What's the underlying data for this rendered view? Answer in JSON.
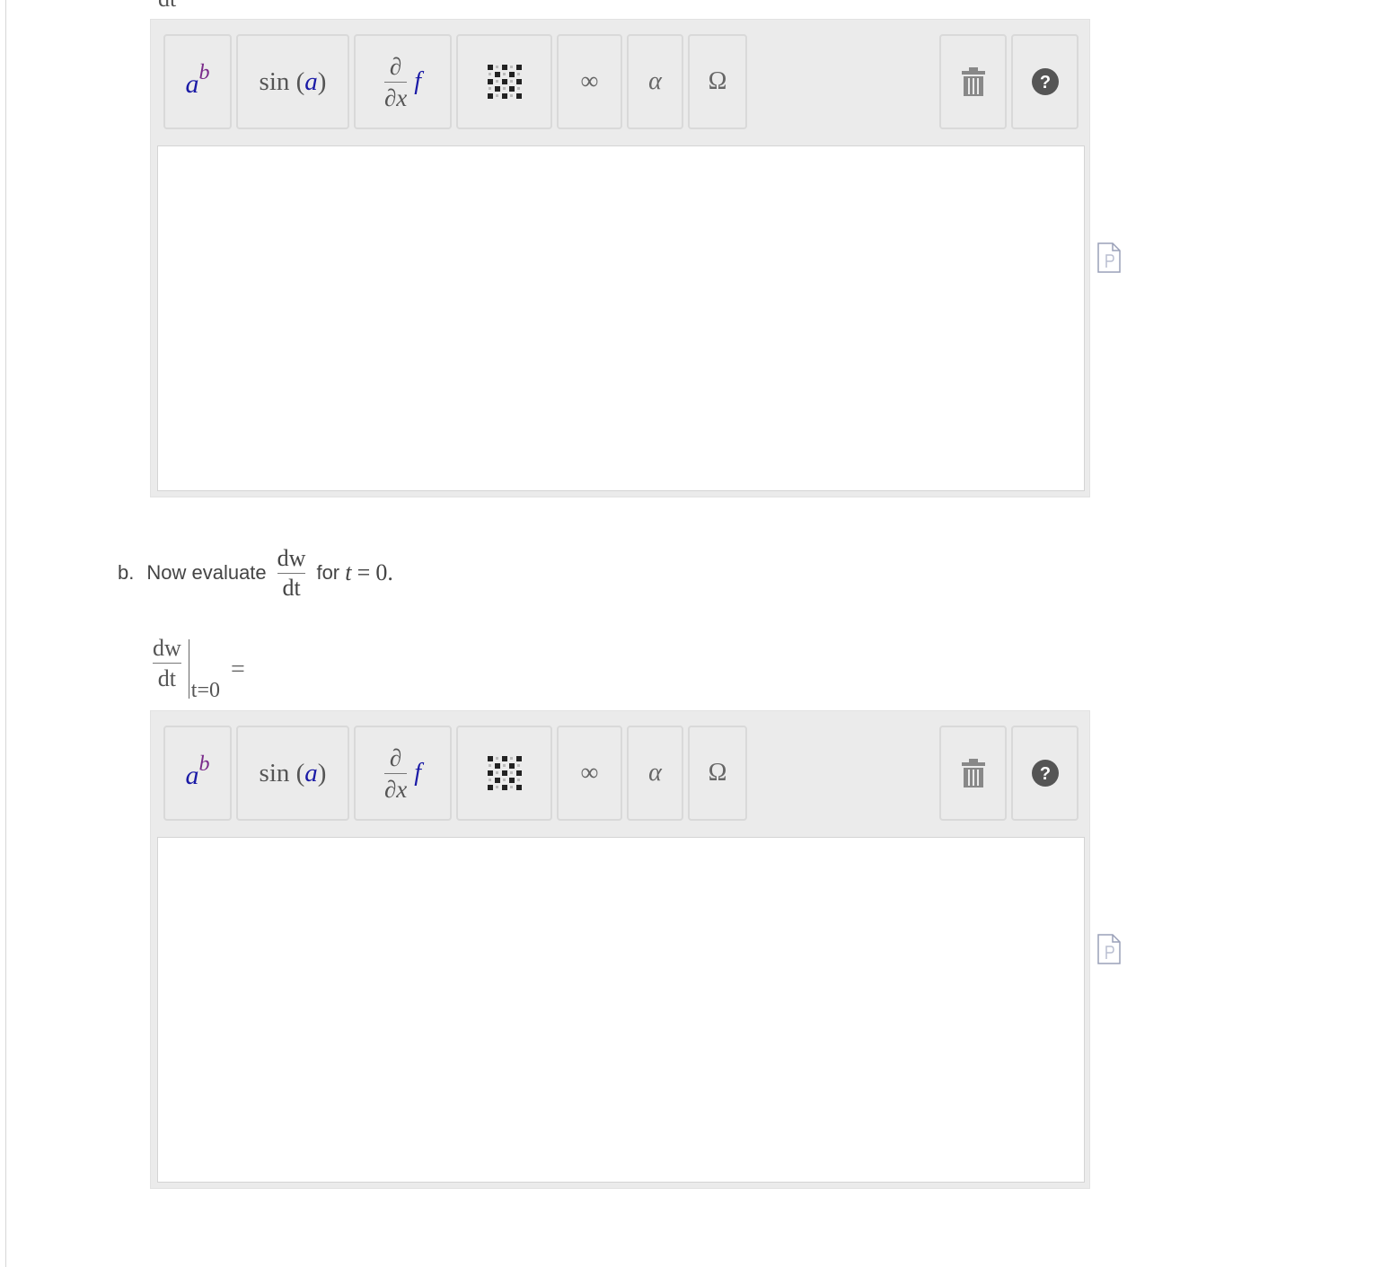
{
  "top_partial_text": "dt",
  "toolbar": {
    "power": {
      "base": "a",
      "exp": "b"
    },
    "sin": {
      "fn": "sin",
      "open": "(",
      "arg": "a",
      "close": ")"
    },
    "derivative": {
      "num": "∂",
      "den": "∂x",
      "fn": "f"
    },
    "matrix_icon": "matrix-icon",
    "infinity": "∞",
    "alpha": "α",
    "omega": "Ω",
    "trash_icon": "trash-icon",
    "help": "?"
  },
  "question_b": {
    "label": "b.",
    "text_before": "Now evaluate",
    "frac_num": "dw",
    "frac_den": "dt",
    "text_for": "for",
    "var": "t",
    "eq": "=",
    "value": "0."
  },
  "evaluation": {
    "num": "dw",
    "den": "dt",
    "subscript": "t=0",
    "equals": "="
  },
  "colors": {
    "toolbar_bg": "#ebebeb",
    "accent_blue": "#1a1aa6",
    "accent_purple": "#7a2a8a"
  }
}
